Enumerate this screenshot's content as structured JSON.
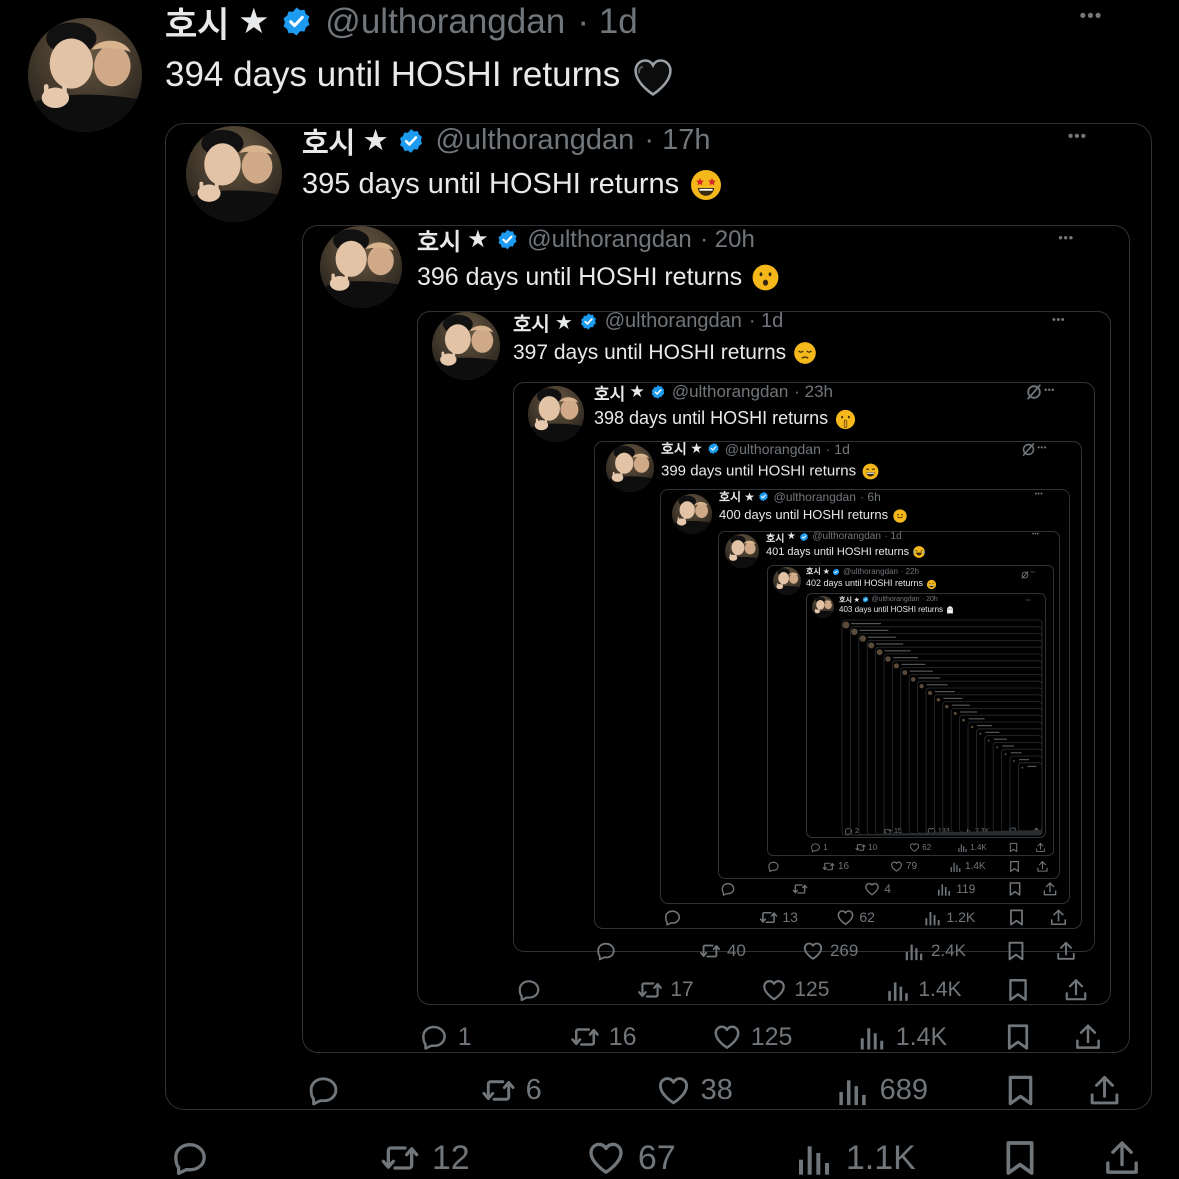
{
  "tweets": [
    {
      "name": "호시",
      "star": "★",
      "handle": "@ulthorangdan",
      "time": "· 1d",
      "text": "394 days until HOSHI returns",
      "emoji": "black-heart",
      "stats": {
        "reply": "",
        "retweet": "12",
        "like": "67",
        "views": "1.1K"
      }
    },
    {
      "name": "호시",
      "star": "★",
      "handle": "@ulthorangdan",
      "time": "· 17h",
      "text": "395 days until HOSHI returns",
      "emoji": "star-struck",
      "stats": {
        "reply": "",
        "retweet": "6",
        "like": "38",
        "views": "689"
      }
    },
    {
      "name": "호시",
      "star": "★",
      "handle": "@ulthorangdan",
      "time": "· 20h",
      "text": "396 days until HOSHI returns",
      "emoji": "hushed-face",
      "stats": {
        "reply": "1",
        "retweet": "16",
        "like": "125",
        "views": "1.4K"
      }
    },
    {
      "name": "호시",
      "star": "★",
      "handle": "@ulthorangdan",
      "time": "· 1d",
      "text": "397 days until HOSHI returns",
      "emoji": "pensive-face",
      "stats": {
        "reply": "",
        "retweet": "17",
        "like": "125",
        "views": "1.4K"
      }
    },
    {
      "name": "호시",
      "star": "★",
      "handle": "@ulthorangdan",
      "time": "· 23h",
      "text": "398 days until HOSHI returns",
      "emoji": "shushing-face",
      "stats": {
        "reply": "",
        "retweet": "40",
        "like": "269",
        "views": "2.4K"
      }
    },
    {
      "name": "호시",
      "star": "★",
      "handle": "@ulthorangdan",
      "time": "· 1d",
      "text": "399 days until HOSHI returns",
      "emoji": "grinning-face",
      "stats": {
        "reply": "",
        "retweet": "13",
        "like": "62",
        "views": "1.2K"
      }
    },
    {
      "name": "호시",
      "star": "★",
      "handle": "@ulthorangdan",
      "time": "· 6h",
      "text": "400 days until HOSHI returns",
      "emoji": "melting-face",
      "stats": {
        "reply": "",
        "retweet": "",
        "like": "4",
        "views": "119"
      }
    },
    {
      "name": "호시",
      "star": "★",
      "handle": "@ulthorangdan",
      "time": "· 1d",
      "text": "401 days until HOSHI returns",
      "emoji": "face-with-tears",
      "stats": {
        "reply": "",
        "retweet": "16",
        "like": "79",
        "views": "1.4K"
      }
    },
    {
      "name": "호시",
      "star": "★",
      "handle": "@ulthorangdan",
      "time": "· 22h",
      "text": "402 days until HOSHI returns",
      "emoji": "grinning-face",
      "stats": {
        "reply": "1",
        "retweet": "10",
        "like": "62",
        "views": "1.4K"
      }
    },
    {
      "name": "호시",
      "star": "★",
      "handle": "@ulthorangdan",
      "time": "· 20h",
      "text": "403 days until HOSHI returns",
      "emoji": "ghost",
      "stats": {
        "reply": "2",
        "retweet": "15",
        "like": "133",
        "views": "2.3K"
      }
    }
  ],
  "colors": {
    "background": "#000000",
    "text": "#e7e9ea",
    "muted": "#71767b",
    "border": "#2f3336",
    "verified": "#1d9bf0",
    "emoji": "#f5b81a"
  },
  "icons": {
    "reply": "reply-icon",
    "retweet": "retweet-icon",
    "like": "heart-icon",
    "views": "views-icon",
    "bookmark": "bookmark-icon",
    "share": "share-icon",
    "more": "more-icon",
    "grok": "grok-icon"
  }
}
